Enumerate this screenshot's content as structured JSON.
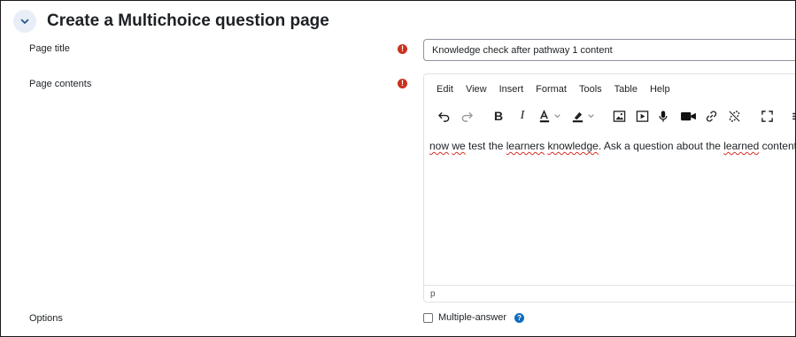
{
  "section": {
    "title": "Create a Multichoice question page",
    "toggle_icon": "chevron-down-icon"
  },
  "fields": {
    "page_title_label": "Page title",
    "page_title_value": "Knowledge check after pathway 1 content",
    "page_contents_label": "Page contents",
    "options_label": "Options",
    "required_icon": "exclamation-circle-icon"
  },
  "editor": {
    "menu": [
      "Edit",
      "View",
      "Insert",
      "Format",
      "Tools",
      "Table",
      "Help"
    ],
    "toolbar": [
      "undo-icon",
      "redo-icon",
      "bold-icon",
      "italic-icon",
      "text-color-icon",
      "highlight-color-icon",
      "image-icon",
      "media-icon",
      "microphone-icon",
      "video-camera-icon",
      "link-icon",
      "unlink-icon",
      "fullscreen-icon",
      "more-icon"
    ],
    "content_parts": [
      "now",
      " ",
      "we",
      " test the ",
      "learners",
      " ",
      "knowledge",
      ". Ask a question about the ",
      "learned",
      " content."
    ],
    "status_path": "p"
  },
  "options": {
    "multiple_answer_label": "Multiple-answer",
    "multiple_answer_checked": false
  },
  "colors": {
    "required": "#ca3120",
    "help": "#0f6cbf",
    "toggle_bg": "#e7eef7"
  }
}
